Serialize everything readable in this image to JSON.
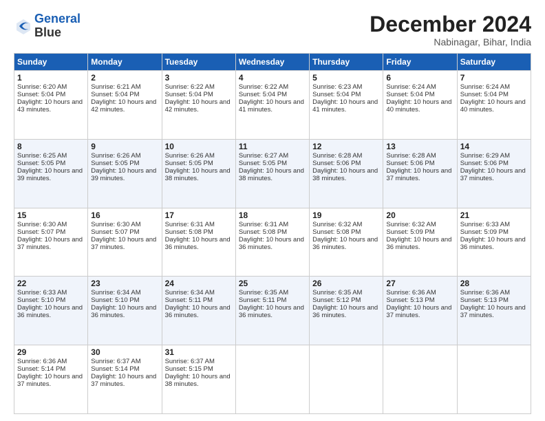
{
  "header": {
    "logo_line1": "General",
    "logo_line2": "Blue",
    "month_title": "December 2024",
    "location": "Nabinagar, Bihar, India"
  },
  "days_of_week": [
    "Sunday",
    "Monday",
    "Tuesday",
    "Wednesday",
    "Thursday",
    "Friday",
    "Saturday"
  ],
  "weeks": [
    [
      {
        "day": "1",
        "sunrise": "Sunrise: 6:20 AM",
        "sunset": "Sunset: 5:04 PM",
        "daylight": "Daylight: 10 hours and 43 minutes."
      },
      {
        "day": "2",
        "sunrise": "Sunrise: 6:21 AM",
        "sunset": "Sunset: 5:04 PM",
        "daylight": "Daylight: 10 hours and 42 minutes."
      },
      {
        "day": "3",
        "sunrise": "Sunrise: 6:22 AM",
        "sunset": "Sunset: 5:04 PM",
        "daylight": "Daylight: 10 hours and 42 minutes."
      },
      {
        "day": "4",
        "sunrise": "Sunrise: 6:22 AM",
        "sunset": "Sunset: 5:04 PM",
        "daylight": "Daylight: 10 hours and 41 minutes."
      },
      {
        "day": "5",
        "sunrise": "Sunrise: 6:23 AM",
        "sunset": "Sunset: 5:04 PM",
        "daylight": "Daylight: 10 hours and 41 minutes."
      },
      {
        "day": "6",
        "sunrise": "Sunrise: 6:24 AM",
        "sunset": "Sunset: 5:04 PM",
        "daylight": "Daylight: 10 hours and 40 minutes."
      },
      {
        "day": "7",
        "sunrise": "Sunrise: 6:24 AM",
        "sunset": "Sunset: 5:04 PM",
        "daylight": "Daylight: 10 hours and 40 minutes."
      }
    ],
    [
      {
        "day": "8",
        "sunrise": "Sunrise: 6:25 AM",
        "sunset": "Sunset: 5:05 PM",
        "daylight": "Daylight: 10 hours and 39 minutes."
      },
      {
        "day": "9",
        "sunrise": "Sunrise: 6:26 AM",
        "sunset": "Sunset: 5:05 PM",
        "daylight": "Daylight: 10 hours and 39 minutes."
      },
      {
        "day": "10",
        "sunrise": "Sunrise: 6:26 AM",
        "sunset": "Sunset: 5:05 PM",
        "daylight": "Daylight: 10 hours and 38 minutes."
      },
      {
        "day": "11",
        "sunrise": "Sunrise: 6:27 AM",
        "sunset": "Sunset: 5:05 PM",
        "daylight": "Daylight: 10 hours and 38 minutes."
      },
      {
        "day": "12",
        "sunrise": "Sunrise: 6:28 AM",
        "sunset": "Sunset: 5:06 PM",
        "daylight": "Daylight: 10 hours and 38 minutes."
      },
      {
        "day": "13",
        "sunrise": "Sunrise: 6:28 AM",
        "sunset": "Sunset: 5:06 PM",
        "daylight": "Daylight: 10 hours and 37 minutes."
      },
      {
        "day": "14",
        "sunrise": "Sunrise: 6:29 AM",
        "sunset": "Sunset: 5:06 PM",
        "daylight": "Daylight: 10 hours and 37 minutes."
      }
    ],
    [
      {
        "day": "15",
        "sunrise": "Sunrise: 6:30 AM",
        "sunset": "Sunset: 5:07 PM",
        "daylight": "Daylight: 10 hours and 37 minutes."
      },
      {
        "day": "16",
        "sunrise": "Sunrise: 6:30 AM",
        "sunset": "Sunset: 5:07 PM",
        "daylight": "Daylight: 10 hours and 37 minutes."
      },
      {
        "day": "17",
        "sunrise": "Sunrise: 6:31 AM",
        "sunset": "Sunset: 5:08 PM",
        "daylight": "Daylight: 10 hours and 36 minutes."
      },
      {
        "day": "18",
        "sunrise": "Sunrise: 6:31 AM",
        "sunset": "Sunset: 5:08 PM",
        "daylight": "Daylight: 10 hours and 36 minutes."
      },
      {
        "day": "19",
        "sunrise": "Sunrise: 6:32 AM",
        "sunset": "Sunset: 5:08 PM",
        "daylight": "Daylight: 10 hours and 36 minutes."
      },
      {
        "day": "20",
        "sunrise": "Sunrise: 6:32 AM",
        "sunset": "Sunset: 5:09 PM",
        "daylight": "Daylight: 10 hours and 36 minutes."
      },
      {
        "day": "21",
        "sunrise": "Sunrise: 6:33 AM",
        "sunset": "Sunset: 5:09 PM",
        "daylight": "Daylight: 10 hours and 36 minutes."
      }
    ],
    [
      {
        "day": "22",
        "sunrise": "Sunrise: 6:33 AM",
        "sunset": "Sunset: 5:10 PM",
        "daylight": "Daylight: 10 hours and 36 minutes."
      },
      {
        "day": "23",
        "sunrise": "Sunrise: 6:34 AM",
        "sunset": "Sunset: 5:10 PM",
        "daylight": "Daylight: 10 hours and 36 minutes."
      },
      {
        "day": "24",
        "sunrise": "Sunrise: 6:34 AM",
        "sunset": "Sunset: 5:11 PM",
        "daylight": "Daylight: 10 hours and 36 minutes."
      },
      {
        "day": "25",
        "sunrise": "Sunrise: 6:35 AM",
        "sunset": "Sunset: 5:11 PM",
        "daylight": "Daylight: 10 hours and 36 minutes."
      },
      {
        "day": "26",
        "sunrise": "Sunrise: 6:35 AM",
        "sunset": "Sunset: 5:12 PM",
        "daylight": "Daylight: 10 hours and 36 minutes."
      },
      {
        "day": "27",
        "sunrise": "Sunrise: 6:36 AM",
        "sunset": "Sunset: 5:13 PM",
        "daylight": "Daylight: 10 hours and 37 minutes."
      },
      {
        "day": "28",
        "sunrise": "Sunrise: 6:36 AM",
        "sunset": "Sunset: 5:13 PM",
        "daylight": "Daylight: 10 hours and 37 minutes."
      }
    ],
    [
      {
        "day": "29",
        "sunrise": "Sunrise: 6:36 AM",
        "sunset": "Sunset: 5:14 PM",
        "daylight": "Daylight: 10 hours and 37 minutes."
      },
      {
        "day": "30",
        "sunrise": "Sunrise: 6:37 AM",
        "sunset": "Sunset: 5:14 PM",
        "daylight": "Daylight: 10 hours and 37 minutes."
      },
      {
        "day": "31",
        "sunrise": "Sunrise: 6:37 AM",
        "sunset": "Sunset: 5:15 PM",
        "daylight": "Daylight: 10 hours and 38 minutes."
      },
      null,
      null,
      null,
      null
    ]
  ]
}
